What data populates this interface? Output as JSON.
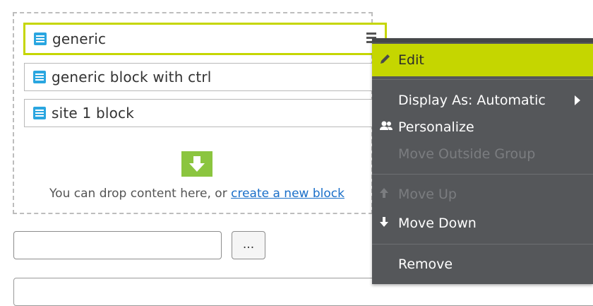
{
  "blocks": [
    {
      "label": "generic"
    },
    {
      "label": "generic block with ctrl"
    },
    {
      "label": "site 1 block"
    }
  ],
  "drop_zone": {
    "text": "You can drop content here, or ",
    "link": "create a new block"
  },
  "dots_button": {
    "label": "..."
  },
  "context_menu": {
    "edit": "Edit",
    "display_as": "Display As: Automatic",
    "personalize": "Personalize",
    "move_outside": "Move Outside Group",
    "move_up": "Move Up",
    "move_down": "Move Down",
    "remove": "Remove"
  },
  "colors": {
    "accent": "#c5d600",
    "block_icon": "#2aa6e0",
    "drop_arrow": "#8bc53f",
    "menu_bg": "#55575a"
  },
  "icons": {
    "block": "block-icon",
    "menu": "hamburger-menu-icon",
    "edit": "pencil-icon",
    "personalize": "users-icon",
    "move_up": "arrow-up-icon",
    "move_down": "arrow-down-icon",
    "drop": "arrow-down-icon"
  }
}
